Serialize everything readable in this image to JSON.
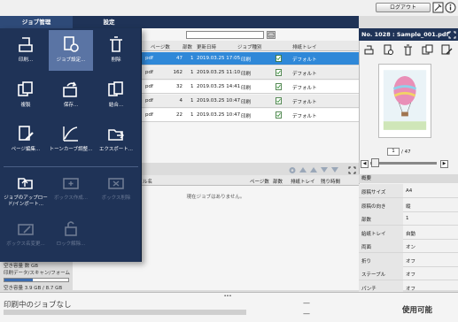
{
  "header": {
    "logout_label": "ログアウト",
    "tools_icon": "tools-icon",
    "info_icon": "info-icon"
  },
  "tabs": [
    {
      "label": "ジョブ管理",
      "active": true
    },
    {
      "label": "設定",
      "active": false
    }
  ],
  "job_list": {
    "columns": [
      "ページ数",
      "部数",
      "更新日時",
      "ジョブ種別",
      "",
      "排紙トレイ"
    ],
    "rows": [
      {
        "name": "pdf",
        "pages": "47",
        "copies": "1",
        "updated": "2019.03.25 17:05",
        "type": "印刷",
        "tray": "デフォルト",
        "selected": true
      },
      {
        "name": "pdf",
        "pages": "162",
        "copies": "1",
        "updated": "2019.03.25 11:10",
        "type": "印刷",
        "tray": "デフォルト",
        "selected": false
      },
      {
        "name": "pdf",
        "pages": "32",
        "copies": "1",
        "updated": "2019.03.25 14:41",
        "type": "印刷",
        "tray": "デフォルト",
        "selected": false
      },
      {
        "name": "pdf",
        "pages": "4",
        "copies": "1",
        "updated": "2019.03.25 10:47",
        "type": "印刷",
        "tray": "デフォルト",
        "selected": false
      },
      {
        "name": "pdf",
        "pages": "22",
        "copies": "1",
        "updated": "2019.03.25 10:47",
        "type": "印刷",
        "tray": "デフォルト",
        "selected": false
      }
    ]
  },
  "queue": {
    "columns": [
      "ァイル名",
      "ページ数",
      "部数",
      "排紙トレイ",
      "残り時間"
    ],
    "empty_message": "現在ジョブはありません。"
  },
  "job_menu": {
    "items": [
      {
        "label": "印刷...",
        "icon": "print-icon",
        "state": "normal"
      },
      {
        "label": "ジョブ設定...",
        "icon": "job-settings-icon",
        "state": "active"
      },
      {
        "label": "削除",
        "icon": "trash-icon",
        "state": "normal"
      },
      {
        "label": "複製",
        "icon": "duplicate-icon",
        "state": "normal"
      },
      {
        "label": "保存...",
        "icon": "save-icon",
        "state": "normal"
      },
      {
        "label": "結合...",
        "icon": "merge-icon",
        "state": "normal"
      },
      {
        "label": "ページ編集...",
        "icon": "page-edit-icon",
        "state": "normal"
      },
      {
        "label": "トーンカーブ調整...",
        "icon": "tone-curve-icon",
        "state": "normal"
      },
      {
        "label": "エクスポート...",
        "icon": "export-icon",
        "state": "normal"
      },
      {
        "label": "ジョブのアップロード/インポート...",
        "icon": "upload-icon",
        "state": "normal"
      },
      {
        "label": "ボックス作成...",
        "icon": "box-create-icon",
        "state": "disabled"
      },
      {
        "label": "ボックス削除",
        "icon": "box-delete-icon",
        "state": "disabled"
      },
      {
        "label": "ボックス名変更...",
        "icon": "box-rename-icon",
        "state": "disabled"
      },
      {
        "label": "ロック解除...",
        "icon": "unlock-icon",
        "state": "disabled"
      }
    ]
  },
  "storage": {
    "line1": "空き容量 数 GB",
    "line2": "印刷データ/スキャン/フォーム",
    "line3": "空き容量 3.9 GB / 8.7 GB",
    "used_fraction": 0.45
  },
  "preview": {
    "title": "No. 1028 : Sample_001.pdf",
    "page_current": "1",
    "page_total": "/ 47",
    "slider_position": 0.02,
    "summary_title": "概要",
    "summary": [
      {
        "key": "原稿サイズ",
        "value": "A4"
      },
      {
        "key": "原稿の向き",
        "value": "縦"
      },
      {
        "key": "部数",
        "value": "1"
      },
      {
        "key": "給紙トレイ",
        "value": "自動"
      },
      {
        "key": "両面",
        "value": "オン"
      },
      {
        "key": "折り",
        "value": "オフ"
      },
      {
        "key": "ステープル",
        "value": "オフ"
      },
      {
        "key": "パンチ",
        "value": "オフ"
      }
    ]
  },
  "status": {
    "printing": "印刷中のジョブなし",
    "dash1": "—",
    "dash2": "—",
    "ready": "使用可能",
    "splitter": "•••"
  },
  "colors": {
    "navy": "#1f3357",
    "selection": "#2f88d8",
    "active_menu": "#5a74a4"
  }
}
